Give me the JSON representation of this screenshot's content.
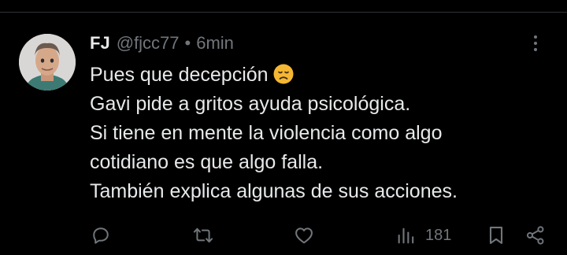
{
  "post": {
    "author_name": "FJ",
    "handle": "@fjcc77",
    "separator": "•",
    "time": "6min",
    "lines": [
      "Pues que decepción",
      "Gavi pide a gritos ayuda psicológica.",
      "Si tiene en mente la violencia como algo",
      "cotidiano es que algo falla.",
      "También explica algunas de sus acciones."
    ],
    "emoji": "disappointed-face-emoji"
  },
  "actions": {
    "reply_icon": "reply-icon",
    "retweet_icon": "retweet-icon",
    "like_icon": "like-icon",
    "views_icon": "views-icon",
    "views_count": "181",
    "bookmark_icon": "bookmark-icon",
    "share_icon": "share-icon"
  },
  "colors": {
    "background": "#000000",
    "text_primary": "#e7e9ea",
    "text_secondary": "#71767b",
    "divider": "#2f3336",
    "emoji": "#f5b733"
  }
}
